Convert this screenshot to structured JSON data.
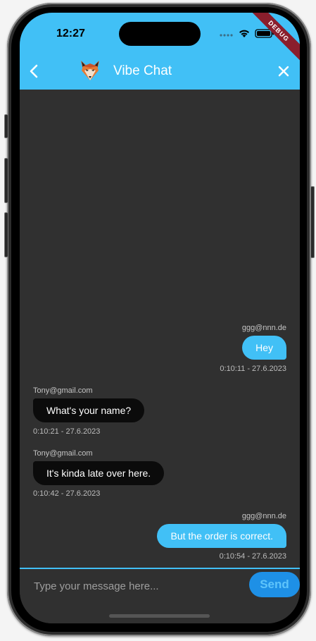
{
  "status_bar": {
    "time": "12:27",
    "debug_label": "DEBUG",
    "icons": [
      "signal-icon",
      "wifi-icon",
      "battery-icon"
    ]
  },
  "header": {
    "title": "Vibe Chat",
    "logo": "fox-logo",
    "back_icon": "chevron-left-icon",
    "close_icon": "close-icon"
  },
  "messages": [
    {
      "sender": "ggg@nnn.de",
      "text": "Hey",
      "time": "0:10:11 - 27.6.2023",
      "direction": "sent"
    },
    {
      "sender": "Tony@gmail.com",
      "text": "What's your name?",
      "time": "0:10:21 - 27.6.2023",
      "direction": "received"
    },
    {
      "sender": "Tony@gmail.com",
      "text": "It's kinda late over here.",
      "time": "0:10:42 - 27.6.2023",
      "direction": "received"
    },
    {
      "sender": "ggg@nnn.de",
      "text": "But the order is correct.",
      "time": "0:10:54 - 27.6.2023",
      "direction": "sent"
    }
  ],
  "composer": {
    "placeholder": "Type your message here...",
    "value": "",
    "send_label": "Send"
  },
  "colors": {
    "accent": "#41c0f6",
    "send_button": "#1e90e6",
    "background": "#303030",
    "received_bubble": "#0b0b0b"
  }
}
